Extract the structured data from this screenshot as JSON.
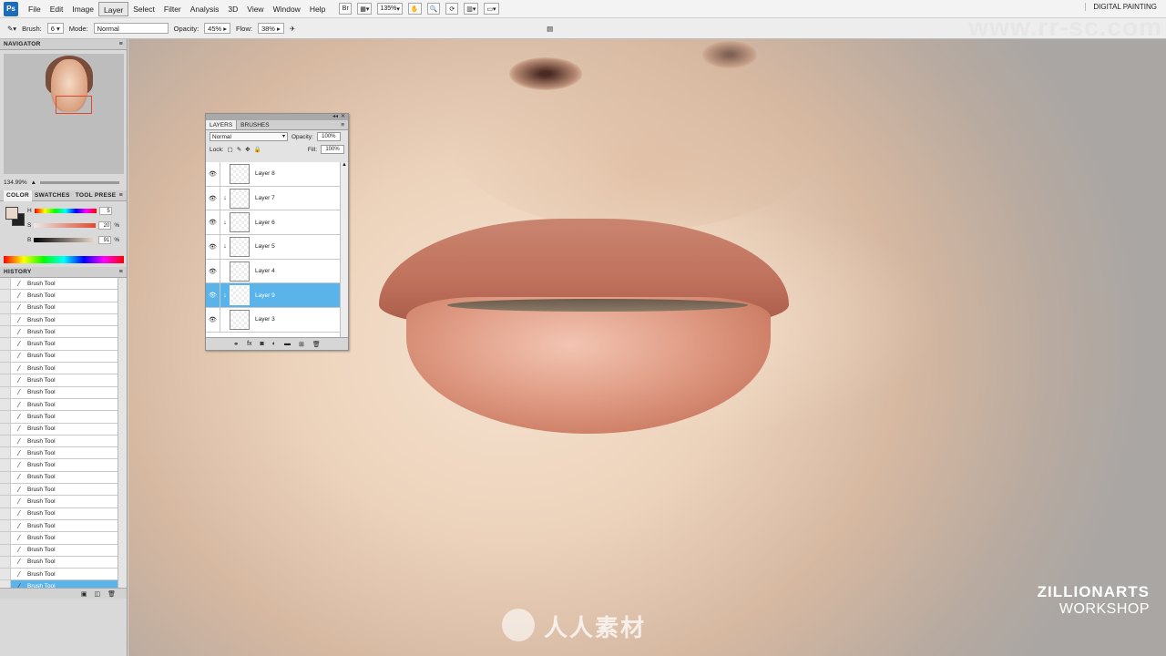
{
  "app": {
    "logo": "Ps",
    "workspace": "DIGITAL PAINTING"
  },
  "menu": [
    "File",
    "Edit",
    "Image",
    "Layer",
    "Select",
    "Filter",
    "Analysis",
    "3D",
    "View",
    "Window",
    "Help"
  ],
  "menubar_controls": {
    "bridge": "Br",
    "zoom": "135%"
  },
  "options": {
    "brush_label": "Brush:",
    "brush_size": "6",
    "mode_label": "Mode:",
    "mode_value": "Normal",
    "opacity_label": "Opacity:",
    "opacity_value": "45%",
    "flow_label": "Flow:",
    "flow_value": "38%"
  },
  "watermark": "www.rr-sc.com",
  "navigator": {
    "title": "NAVIGATOR",
    "zoom": "134.99%"
  },
  "color_panel": {
    "tabs": [
      "COLOR",
      "SWATCHES",
      "TOOL PRESE"
    ],
    "h_label": "H",
    "h_value": "5",
    "s_label": "S",
    "s_value": "20",
    "s_unit": "%",
    "b_label": "B",
    "b_value": "91",
    "b_unit": "%"
  },
  "history": {
    "title": "HISTORY",
    "items": [
      "Brush Tool",
      "Brush Tool",
      "Brush Tool",
      "Brush Tool",
      "Brush Tool",
      "Brush Tool",
      "Brush Tool",
      "Brush Tool",
      "Brush Tool",
      "Brush Tool",
      "Brush Tool",
      "Brush Tool",
      "Brush Tool",
      "Brush Tool",
      "Brush Tool",
      "Brush Tool",
      "Brush Tool",
      "Brush Tool",
      "Brush Tool",
      "Brush Tool",
      "Brush Tool",
      "Brush Tool",
      "Brush Tool",
      "Brush Tool",
      "Brush Tool",
      "Brush Tool"
    ],
    "selected_index": 25
  },
  "layers": {
    "tabs": [
      "LAYERS",
      "BRUSHES"
    ],
    "blend_mode": "Normal",
    "opacity_label": "Opacity:",
    "opacity_value": "100%",
    "lock_label": "Lock:",
    "fill_label": "Fill:",
    "fill_value": "100%",
    "items": [
      {
        "name": "Layer 8",
        "clipped": false
      },
      {
        "name": "Layer 7",
        "clipped": true
      },
      {
        "name": "Layer 6",
        "clipped": true
      },
      {
        "name": "Layer 5",
        "clipped": true
      },
      {
        "name": "Layer 4",
        "clipped": false
      },
      {
        "name": "Layer 9",
        "clipped": true
      },
      {
        "name": "Layer 3",
        "clipped": false
      }
    ],
    "selected_index": 5
  },
  "branding": {
    "line1": "ZILLIONARTS",
    "line2": "WORKSHOP",
    "bottom_watermark": "人人素材"
  },
  "colors": {
    "accent": "#5ab4ea",
    "ps_blue": "#1e6bb8"
  }
}
